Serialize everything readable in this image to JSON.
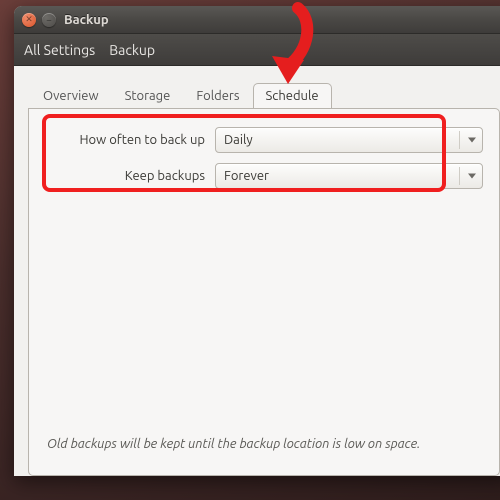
{
  "window": {
    "title": "Backup"
  },
  "toolbar": {
    "breadcrumbs": [
      "All Settings",
      "Backup"
    ]
  },
  "tabs": {
    "items": [
      "Overview",
      "Storage",
      "Folders",
      "Schedule"
    ],
    "active": "Schedule"
  },
  "schedule": {
    "frequency_label": "How often to back up",
    "frequency_value": "Daily",
    "keep_label": "Keep backups",
    "keep_value": "Forever"
  },
  "footer": {
    "note": "Old backups will be kept until the backup location is low on space."
  },
  "annotations": {
    "highlight": true,
    "arrow_points_to": "tab-schedule"
  }
}
